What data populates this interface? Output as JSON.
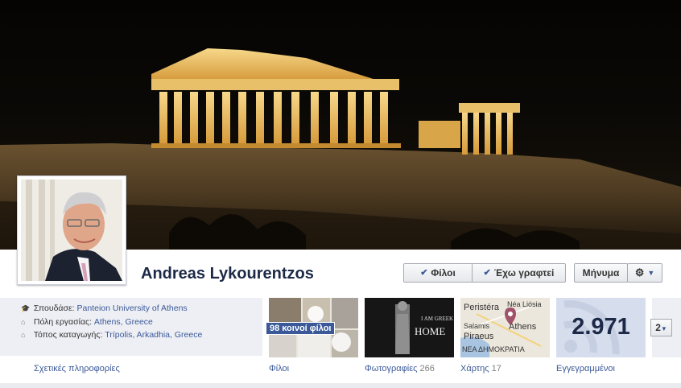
{
  "profile": {
    "name": "Andreas Lykourentzos"
  },
  "actions": {
    "friends_label": "Φίλοι",
    "follow_label": "Έχω γραφτεί",
    "message_label": "Μήνυμα",
    "gear_icon": "gear-icon",
    "check_icon": "check-icon"
  },
  "about": {
    "studies_label": "Σπουδάσε:",
    "studies_value": "Panteion University of Athens",
    "work_city_label": "Πόλη εργασίας:",
    "work_city_value": "Athens, Greece",
    "hometown_label": "Τόπος καταγωγής:",
    "hometown_value": "Trípolis, Arkadhia, Greece",
    "more_link": "Σχετικές πληροφορίες"
  },
  "tiles": {
    "friends": {
      "label": "Φίλοι",
      "badge": "98 κοινοί φίλοι"
    },
    "photos": {
      "label": "Φωτογραφίες",
      "count": "266",
      "poster_text_1": "I AM GREEK",
      "poster_text_2": "HOME"
    },
    "map": {
      "label": "Χάρτης",
      "count": "17",
      "places": [
        "Peristéra",
        "Néa Liósia",
        "Salamis",
        "Athens",
        "Piraeus",
        "ΝΕΑ ΔΗΜΟΚΡΑΤΙΑ"
      ]
    },
    "subscribers": {
      "label": "Εγγεγραμμένοι",
      "count": "2.971"
    }
  },
  "more": {
    "label": "2"
  }
}
